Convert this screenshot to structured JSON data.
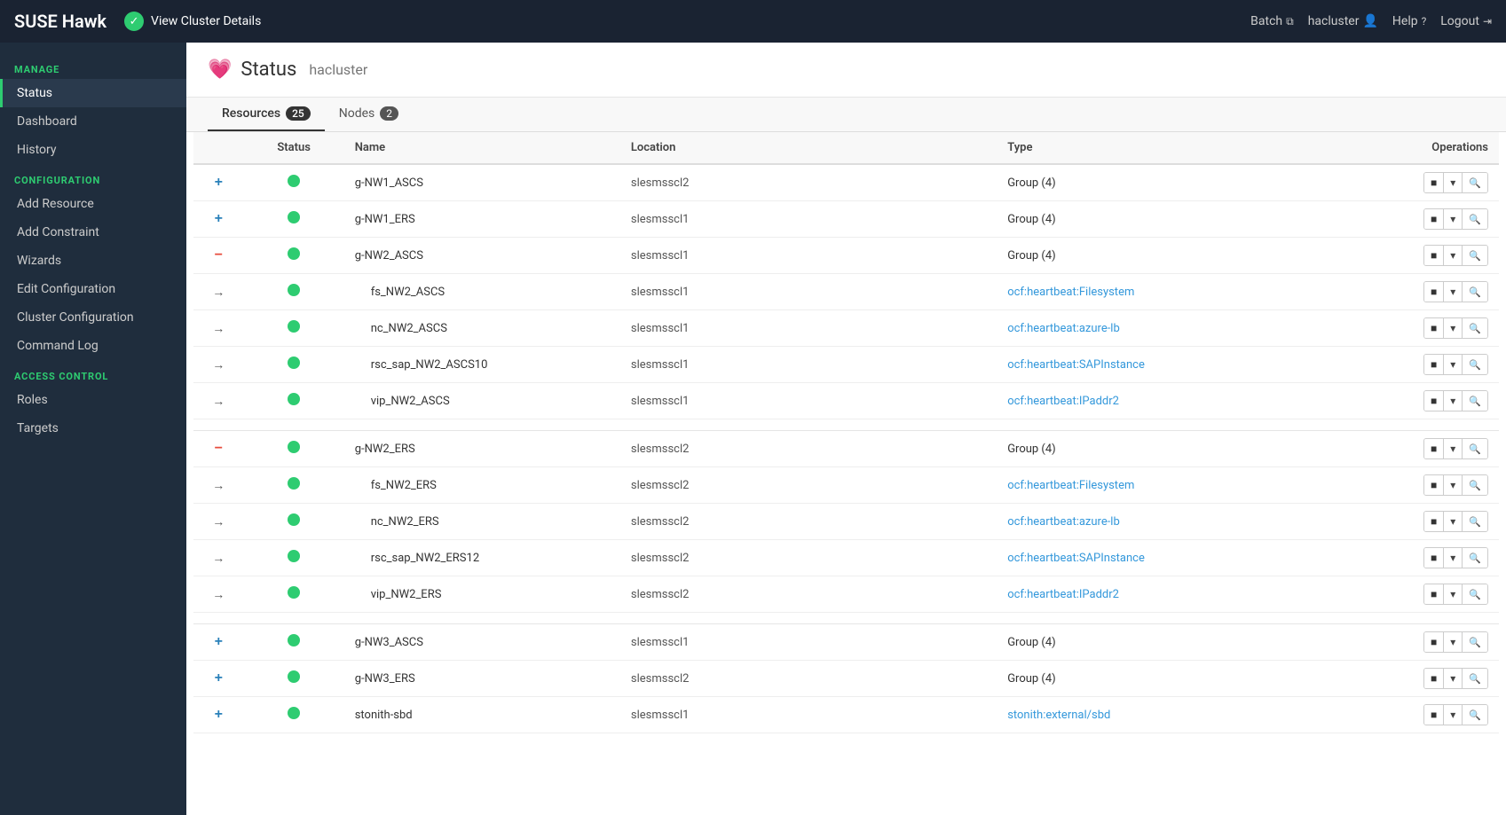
{
  "navbar": {
    "brand": "SUSE Hawk",
    "notification": "View Cluster Details",
    "batch_label": "Batch",
    "cluster_label": "hacluster",
    "help_label": "Help",
    "logout_label": "Logout"
  },
  "sidebar": {
    "manage_label": "MANAGE",
    "manage_items": [
      {
        "id": "status",
        "label": "Status",
        "active": true
      },
      {
        "id": "dashboard",
        "label": "Dashboard"
      },
      {
        "id": "history",
        "label": "History"
      }
    ],
    "config_label": "CONFIGURATION",
    "config_items": [
      {
        "id": "add-resource",
        "label": "Add Resource"
      },
      {
        "id": "add-constraint",
        "label": "Add Constraint"
      },
      {
        "id": "wizards",
        "label": "Wizards"
      },
      {
        "id": "edit-configuration",
        "label": "Edit Configuration"
      },
      {
        "id": "cluster-configuration",
        "label": "Cluster Configuration"
      },
      {
        "id": "command-log",
        "label": "Command Log"
      }
    ],
    "access_label": "ACCESS CONTROL",
    "access_items": [
      {
        "id": "roles",
        "label": "Roles"
      },
      {
        "id": "targets",
        "label": "Targets"
      }
    ]
  },
  "page": {
    "title": "Status",
    "cluster": "hacluster"
  },
  "tabs": [
    {
      "id": "resources",
      "label": "Resources",
      "badge": "25",
      "active": true
    },
    {
      "id": "nodes",
      "label": "Nodes",
      "badge": "2",
      "active": false
    }
  ],
  "table": {
    "columns": [
      "",
      "Status",
      "Name",
      "Location",
      "Type",
      "Operations"
    ],
    "rows": [
      {
        "toggle": "+",
        "toggle_type": "plus",
        "status": "green",
        "name": "g-NW1_ASCS",
        "location": "slesmsscl2",
        "type": "Group (4)",
        "type_link": false,
        "indent": false
      },
      {
        "toggle": "+",
        "toggle_type": "plus",
        "status": "green",
        "name": "g-NW1_ERS",
        "location": "slesmsscl1",
        "type": "Group (4)",
        "type_link": false,
        "indent": false
      },
      {
        "toggle": "−",
        "toggle_type": "minus",
        "status": "green",
        "name": "g-NW2_ASCS",
        "location": "slesmsscl1",
        "type": "Group (4)",
        "type_link": false,
        "indent": false
      },
      {
        "toggle": "→",
        "toggle_type": "arrow",
        "status": "green",
        "name": "fs_NW2_ASCS",
        "location": "slesmsscl1",
        "type": "ocf:heartbeat:Filesystem",
        "type_link": true,
        "indent": true
      },
      {
        "toggle": "→",
        "toggle_type": "arrow",
        "status": "green",
        "name": "nc_NW2_ASCS",
        "location": "slesmsscl1",
        "type": "ocf:heartbeat:azure-lb",
        "type_link": true,
        "indent": true
      },
      {
        "toggle": "→",
        "toggle_type": "arrow",
        "status": "green",
        "name": "rsc_sap_NW2_ASCS10",
        "location": "slesmsscl1",
        "type": "ocf:heartbeat:SAPInstance",
        "type_link": true,
        "indent": true
      },
      {
        "toggle": "→",
        "toggle_type": "arrow",
        "status": "green",
        "name": "vip_NW2_ASCS",
        "location": "slesmsscl1",
        "type": "ocf:heartbeat:IPaddr2",
        "type_link": true,
        "indent": true
      },
      {
        "toggle": "−",
        "toggle_type": "minus",
        "status": "green",
        "name": "g-NW2_ERS",
        "location": "slesmsscl2",
        "type": "Group (4)",
        "type_link": false,
        "indent": false
      },
      {
        "toggle": "→",
        "toggle_type": "arrow",
        "status": "green",
        "name": "fs_NW2_ERS",
        "location": "slesmsscl2",
        "type": "ocf:heartbeat:Filesystem",
        "type_link": true,
        "indent": true
      },
      {
        "toggle": "→",
        "toggle_type": "arrow",
        "status": "green",
        "name": "nc_NW2_ERS",
        "location": "slesmsscl2",
        "type": "ocf:heartbeat:azure-lb",
        "type_link": true,
        "indent": true
      },
      {
        "toggle": "→",
        "toggle_type": "arrow",
        "status": "green",
        "name": "rsc_sap_NW2_ERS12",
        "location": "slesmsscl2",
        "type": "ocf:heartbeat:SAPInstance",
        "type_link": true,
        "indent": true
      },
      {
        "toggle": "→",
        "toggle_type": "arrow",
        "status": "green",
        "name": "vip_NW2_ERS",
        "location": "slesmsscl2",
        "type": "ocf:heartbeat:IPaddr2",
        "type_link": true,
        "indent": true
      },
      {
        "toggle": "+",
        "toggle_type": "plus",
        "status": "green",
        "name": "g-NW3_ASCS",
        "location": "slesmsscl1",
        "type": "Group (4)",
        "type_link": false,
        "indent": false
      },
      {
        "toggle": "+",
        "toggle_type": "plus",
        "status": "green",
        "name": "g-NW3_ERS",
        "location": "slesmsscl2",
        "type": "Group (4)",
        "type_link": false,
        "indent": false
      },
      {
        "toggle": "+",
        "toggle_type": "plus",
        "status": "green",
        "name": "stonith-sbd",
        "location": "slesmsscl1",
        "type": "stonith:external/sbd",
        "type_link": true,
        "indent": false
      }
    ]
  }
}
